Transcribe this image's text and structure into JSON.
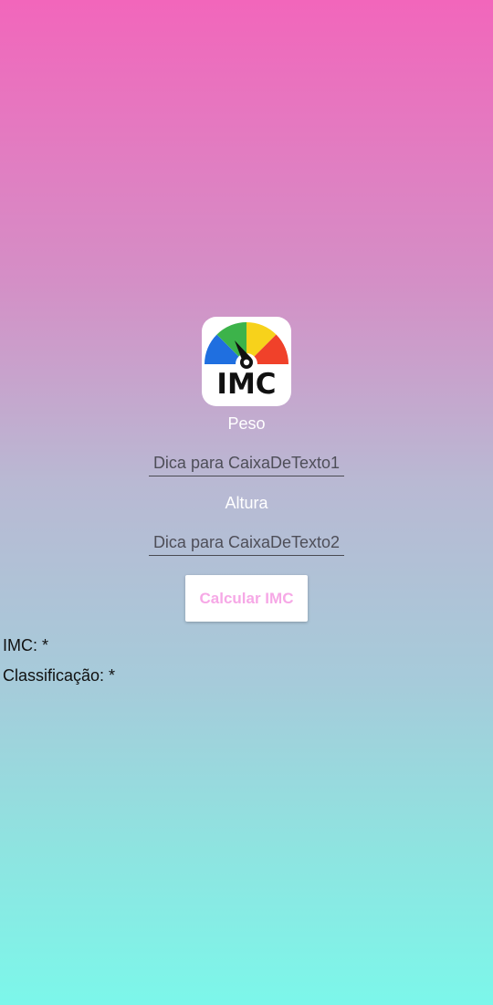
{
  "logo": {
    "icon": "bmi-gauge-icon",
    "text": "IMC",
    "colors": [
      "#1f6fe0",
      "#3cb34a",
      "#f7d21b",
      "#f0412a"
    ]
  },
  "form": {
    "weight_label": "Peso",
    "weight_placeholder": "Dica para CaixaDeTexto1",
    "height_label": "Altura",
    "height_placeholder": "Dica para CaixaDeTexto2",
    "calculate_button": "Calcular IMC"
  },
  "results": {
    "imc_text": "IMC: *",
    "classification_text": "Classificação: *"
  },
  "colors": {
    "gradient_top": "#f266bb",
    "gradient_bottom": "#7cf7ea",
    "button_text": "#f6a8e6"
  }
}
